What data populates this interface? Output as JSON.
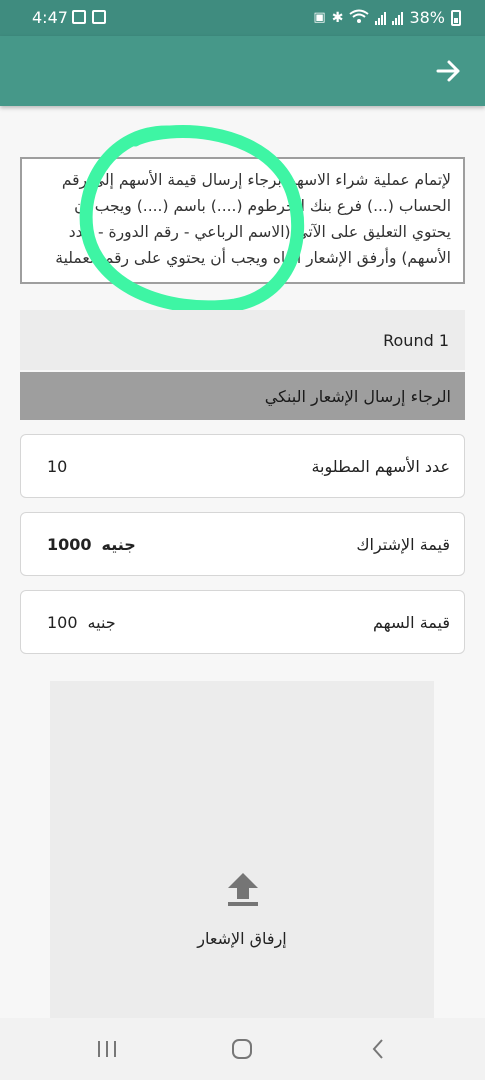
{
  "status_bar": {
    "time": "4:47",
    "battery": "38%",
    "icons": [
      "image-icon",
      "screenshot-icon",
      "lock-icon",
      "bluetooth-icon",
      "wifi-icon",
      "signal-icon",
      "signal-icon",
      "battery-icon"
    ]
  },
  "app_bar": {
    "back_icon": "arrow-right-icon",
    "color": "#469889"
  },
  "instructions": {
    "text": "لإتمام عملية شراء الاسهم برجاء إرسال قيمة الأسهم إلى رقم الحساب (...) فرع بنك الخرطوم (....) باسم (....) ويجب أن يحتوي التعليق على الآتي (الاسم الرباعي - رقم الدورة - عدد الأسهم) وأرفق الإشعار أدناه ويجب أن يحتوي على رقم العملية"
  },
  "round": {
    "label": "Round 1"
  },
  "notice": {
    "text": "الرجاء إرسال الإشعار البنكي"
  },
  "fields": {
    "shares": {
      "label": "عدد الأسهم المطلوبة",
      "value": "10"
    },
    "subscription": {
      "label": "قيمة الإشتراك",
      "amount": "1000",
      "currency": "جنيه"
    },
    "share_price": {
      "label": "قيمة السهم",
      "amount": "100",
      "currency": "جنيه"
    }
  },
  "upload": {
    "icon": "upload-icon",
    "label": "إرفاق الإشعار"
  },
  "nav": {
    "recents_icon": "recents-icon",
    "home_icon": "home-icon",
    "back_icon": "back-chevron-icon"
  },
  "colors": {
    "primary": "#469889",
    "status_bar": "#3f8c7f",
    "highlight": "#3ef5a4",
    "notice_bg": "#9e9e9e"
  }
}
